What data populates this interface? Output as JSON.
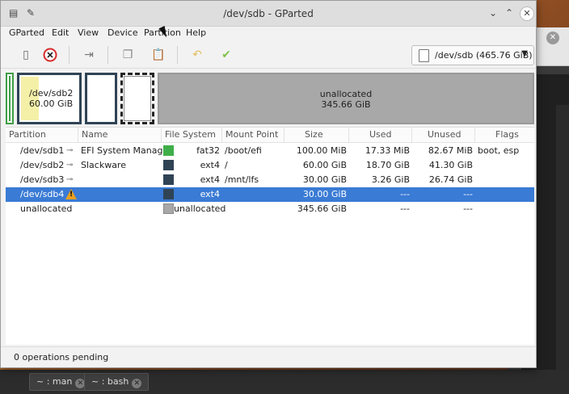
{
  "window": {
    "title": "/dev/sdb - GParted"
  },
  "menubar": [
    "GParted",
    "Edit",
    "View",
    "Device",
    "Partition",
    "Help"
  ],
  "device_selector": {
    "label": "/dev/sdb (465.76 GiB)"
  },
  "disk_graphic": {
    "sdb2": {
      "name": "/dev/sdb2",
      "size": "60.00 GiB"
    },
    "unallocated": {
      "name": "unallocated",
      "size": "345.66 GiB"
    }
  },
  "table": {
    "headers": [
      "Partition",
      "Name",
      "File System",
      "Mount Point",
      "Size",
      "Used",
      "Unused",
      "Flags"
    ],
    "rows": [
      {
        "partition": "/dev/sdb1",
        "name": "EFI System Manager",
        "fs": "fat32",
        "mount": "/boot/efi",
        "size": "100.00 MiB",
        "used": "17.33 MiB",
        "unused": "82.67 MiB",
        "flags": "boot, esp",
        "color": "#3fae49"
      },
      {
        "partition": "/dev/sdb2",
        "name": "Slackware",
        "fs": "ext4",
        "mount": "/",
        "size": "60.00 GiB",
        "used": "18.70 GiB",
        "unused": "41.30 GiB",
        "flags": "",
        "color": "#2f4355"
      },
      {
        "partition": "/dev/sdb3",
        "name": "",
        "fs": "ext4",
        "mount": "/mnt/lfs",
        "size": "30.00 GiB",
        "used": "3.26 GiB",
        "unused": "26.74 GiB",
        "flags": "",
        "color": "#2f4355"
      },
      {
        "partition": "/dev/sdb4",
        "name": "",
        "fs": "ext4",
        "mount": "",
        "size": "30.00 GiB",
        "used": "---",
        "unused": "---",
        "flags": "",
        "color": "#2f4355"
      },
      {
        "partition": "unallocated",
        "name": "",
        "fs": "unallocated",
        "mount": "",
        "size": "345.66 GiB",
        "used": "---",
        "unused": "---",
        "flags": "",
        "color": "#a8a8a8"
      }
    ]
  },
  "status": {
    "text": "0 operations pending"
  },
  "taskbar": {
    "tabs": [
      "~ : man",
      "~ : bash"
    ]
  },
  "colors": {
    "selection": "#3a7bd5",
    "fat32": "#3fae49",
    "ext4": "#2f4355",
    "unallocated": "#a8a8a8"
  }
}
